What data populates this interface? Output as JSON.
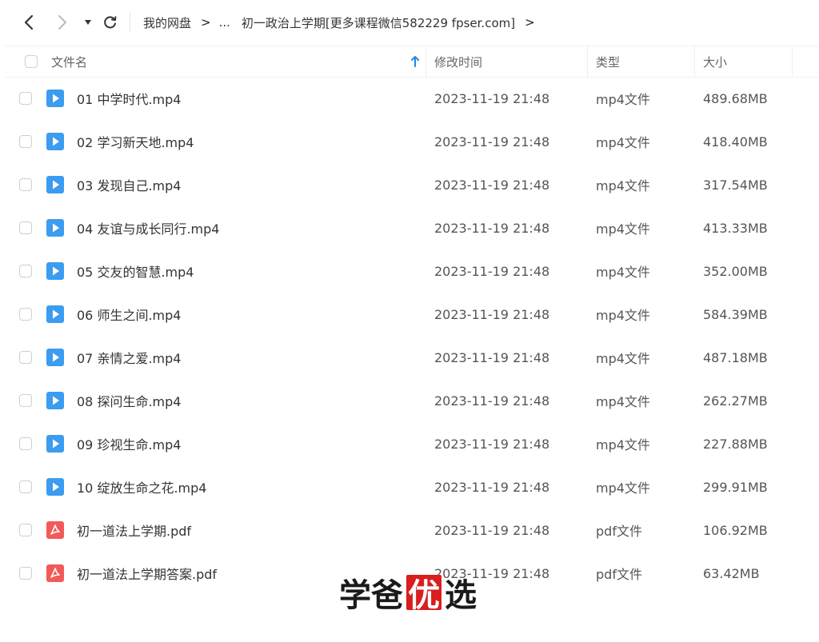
{
  "breadcrumb": {
    "root": "我的网盘",
    "ellipsis": "...",
    "current": "初一政治上学期[更多课程微信582229 fpser.com]"
  },
  "columns": {
    "name": "文件名",
    "modified": "修改时间",
    "type": "类型",
    "size": "大小"
  },
  "files": [
    {
      "name": "01 中学时代.mp4",
      "time": "2023-11-19 21:48",
      "type": "mp4文件",
      "size": "489.68MB",
      "kind": "video"
    },
    {
      "name": "02 学习新天地.mp4",
      "time": "2023-11-19 21:48",
      "type": "mp4文件",
      "size": "418.40MB",
      "kind": "video"
    },
    {
      "name": "03 发现自己.mp4",
      "time": "2023-11-19 21:48",
      "type": "mp4文件",
      "size": "317.54MB",
      "kind": "video"
    },
    {
      "name": "04 友谊与成长同行.mp4",
      "time": "2023-11-19 21:48",
      "type": "mp4文件",
      "size": "413.33MB",
      "kind": "video"
    },
    {
      "name": "05 交友的智慧.mp4",
      "time": "2023-11-19 21:48",
      "type": "mp4文件",
      "size": "352.00MB",
      "kind": "video"
    },
    {
      "name": "06 师生之间.mp4",
      "time": "2023-11-19 21:48",
      "type": "mp4文件",
      "size": "584.39MB",
      "kind": "video"
    },
    {
      "name": "07 亲情之爱.mp4",
      "time": "2023-11-19 21:48",
      "type": "mp4文件",
      "size": "487.18MB",
      "kind": "video"
    },
    {
      "name": "08 探问生命.mp4",
      "time": "2023-11-19 21:48",
      "type": "mp4文件",
      "size": "262.27MB",
      "kind": "video"
    },
    {
      "name": "09 珍视生命.mp4",
      "time": "2023-11-19 21:48",
      "type": "mp4文件",
      "size": "227.88MB",
      "kind": "video"
    },
    {
      "name": "10 绽放生命之花.mp4",
      "time": "2023-11-19 21:48",
      "type": "mp4文件",
      "size": "299.91MB",
      "kind": "video"
    },
    {
      "name": "初一道法上学期.pdf",
      "time": "2023-11-19 21:48",
      "type": "pdf文件",
      "size": "106.92MB",
      "kind": "pdf"
    },
    {
      "name": "初一道法上学期答案.pdf",
      "time": "2023-11-19 21:48",
      "type": "pdf文件",
      "size": "63.42MB",
      "kind": "pdf"
    }
  ],
  "watermark": {
    "part1": "学爸",
    "part2": "优",
    "part3": "选"
  },
  "colors": {
    "video_icon": "#3b9cf0",
    "pdf_icon": "#f25a5a",
    "sort_arrow": "#1e88e5",
    "watermark_red": "#d81e1e"
  },
  "icons": {
    "back": "chevron-left-icon",
    "forward": "chevron-right-icon",
    "dropdown": "caret-down-icon",
    "refresh": "refresh-icon",
    "sort": "arrow-up-icon",
    "video": "video-file-icon",
    "pdf": "pdf-file-icon"
  }
}
